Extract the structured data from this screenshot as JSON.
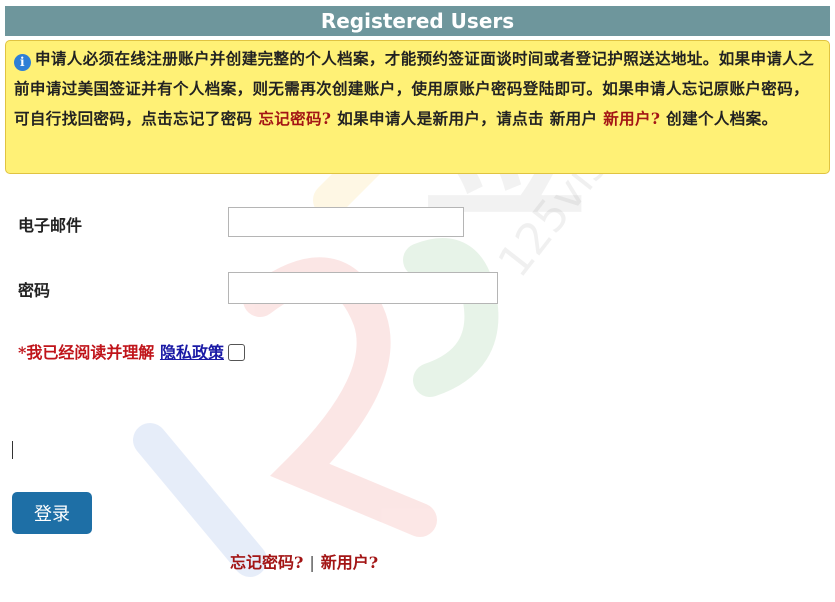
{
  "header": {
    "title": "Registered Users"
  },
  "notice": {
    "icon": "info-icon",
    "text_1": "申请人必须在线注册账户并创建完整的个人档案，才能预约签证面谈时间或者登记护照送达地址。如果申请人之前申请过美国签证并有个人档案，则无需再次创建账户，使用原账户密码登陆即可。如果申请人忘记原账户密码，可自行找回密码，点击忘记了密码 ",
    "forgot_link": "忘记密码?",
    "text_2": " 如果申请人是新用户，请点击 新用户 ",
    "new_user_link": "新用户?",
    "text_3": " 创建个人档案。"
  },
  "form": {
    "email_label": "电子邮件",
    "email_value": "",
    "password_label": "密码",
    "password_value": "",
    "privacy_prefix": "*我已经阅读并理解",
    "privacy_link": "隐私政策",
    "privacy_checked": false,
    "login_label": "登录"
  },
  "footer": {
    "forgot_label": "忘记密码?",
    "separator": "|",
    "new_user_label": "新用户?"
  },
  "watermark": {
    "text": "125visa.com"
  },
  "colors": {
    "header_bg": "#6e969c",
    "notice_bg": "#fff176",
    "link_red": "#a31515",
    "button_blue": "#1e6fa6"
  }
}
